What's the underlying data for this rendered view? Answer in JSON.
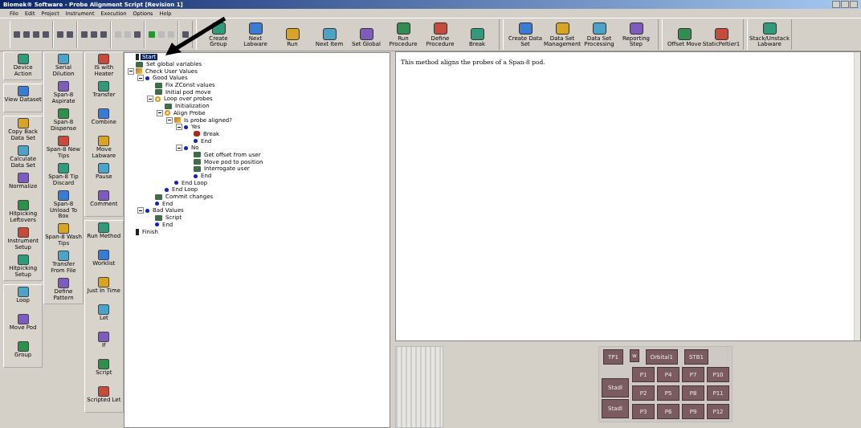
{
  "window": {
    "title": "Biomek® Software - Probe Alignment Script [Revision 1]"
  },
  "menu": [
    "File",
    "Edit",
    "Project",
    "Instrument",
    "Execution",
    "Options",
    "Help"
  ],
  "toolbar": [
    [
      "Create Group",
      "Next Labware",
      "Run",
      "Next Item",
      "Set Global",
      "Run Procedure",
      "Define Procedure",
      "Break"
    ],
    [
      "Create Data Set",
      "Data Set Management",
      "Data Set Processing",
      "Reporting Step"
    ],
    [
      "Offset Move",
      "StaticPeltier1"
    ],
    [
      "Stack/Unstack Labware"
    ]
  ],
  "palette": [
    {
      "groups": [
        {
          "items": [
            "Device Action"
          ]
        },
        {
          "items": [
            "View Dataset"
          ]
        },
        {
          "items": [
            "Copy Back Data Set",
            "Calculate Data Set",
            "Normalize",
            "Hitpicking Leftovers",
            "Instrument Setup",
            "Hitpicking Setup"
          ]
        },
        {
          "items": [
            "Loop",
            "Move Pod",
            "Group"
          ]
        }
      ]
    },
    {
      "groups": [
        {
          "items": [
            "Serial Dilution",
            "Span-8 Aspirate",
            "Span-8 Dispense",
            "Span-8 New Tips",
            "Span-8 Tip Discard",
            "Span-8 Unload To Box",
            "Span-8 Wash Tips",
            "Transfer From File",
            "Define Pattern"
          ]
        }
      ]
    },
    {
      "groups": [
        {
          "items": [
            "IS with Heater",
            "Transfer",
            "Combine",
            "Move Labware",
            "Pause",
            "Comment"
          ]
        },
        {
          "items": [
            "Run Method",
            "Worklist",
            "Just In Time",
            "Let",
            "If",
            "Script",
            "Scripted Let"
          ]
        }
      ]
    }
  ],
  "tree": [
    {
      "label": "Start",
      "kind": "start",
      "selected": true
    },
    {
      "label": "Set global variables",
      "kind": "step",
      "selected": false
    },
    {
      "label": "Check User Values",
      "kind": "if",
      "selected": false,
      "expanded": true,
      "children": [
        {
          "label": "Good Values",
          "kind": "branch",
          "selected": false,
          "expanded": true,
          "children": [
            {
              "label": "Fix ZConst values",
              "kind": "step",
              "selected": false
            },
            {
              "label": "Initial pod move",
              "kind": "step",
              "selected": false
            },
            {
              "label": "Loop over probes",
              "kind": "loop",
              "selected": false,
              "expanded": true,
              "children": [
                {
                  "label": "Initialization",
                  "kind": "step",
                  "selected": false
                },
                {
                  "label": "Align Probe",
                  "kind": "loop",
                  "selected": false,
                  "expanded": true,
                  "children": [
                    {
                      "label": "Is probe aligned?",
                      "kind": "if",
                      "selected": false,
                      "expanded": true,
                      "children": [
                        {
                          "label": "Yes",
                          "kind": "branch",
                          "selected": false,
                          "expanded": true,
                          "children": [
                            {
                              "label": "Break",
                              "kind": "break",
                              "selected": false
                            },
                            {
                              "label": "End",
                              "kind": "end",
                              "selected": false
                            }
                          ]
                        },
                        {
                          "label": "No",
                          "kind": "branch",
                          "selected": false,
                          "expanded": true,
                          "children": [
                            {
                              "label": "Get offset from user",
                              "kind": "step",
                              "selected": false
                            },
                            {
                              "label": "Move pod to position",
                              "kind": "step",
                              "selected": false
                            },
                            {
                              "label": "Interrogate user",
                              "kind": "step",
                              "selected": false
                            },
                            {
                              "label": "End",
                              "kind": "end",
                              "selected": false
                            }
                          ]
                        }
                      ]
                    },
                    {
                      "label": "End Loop",
                      "kind": "end",
                      "selected": false
                    }
                  ]
                },
                {
                  "label": "End Loop",
                  "kind": "end",
                  "selected": false
                }
              ]
            },
            {
              "label": "Commit changes",
              "kind": "step",
              "selected": false
            },
            {
              "label": "End",
              "kind": "end",
              "selected": false
            }
          ]
        },
        {
          "label": "Bad Values",
          "kind": "branch",
          "selected": false,
          "expanded": true,
          "children": [
            {
              "label": "Script",
              "kind": "step",
              "selected": false
            },
            {
              "label": "End",
              "kind": "end",
              "selected": false
            }
          ]
        }
      ]
    },
    {
      "label": "Finish",
      "kind": "finish",
      "selected": false
    }
  ],
  "description": "This method aligns the probes of a Span-8 pod.",
  "deck": {
    "top": [
      "TP1",
      "w",
      "Orbital1",
      "STB1"
    ],
    "side": [
      "Stadl",
      "Stadl"
    ],
    "positions": [
      "P1",
      "P4",
      "P7",
      "P10",
      "P2",
      "P5",
      "P8",
      "P11",
      "P3",
      "P6",
      "P9",
      "P12"
    ]
  }
}
